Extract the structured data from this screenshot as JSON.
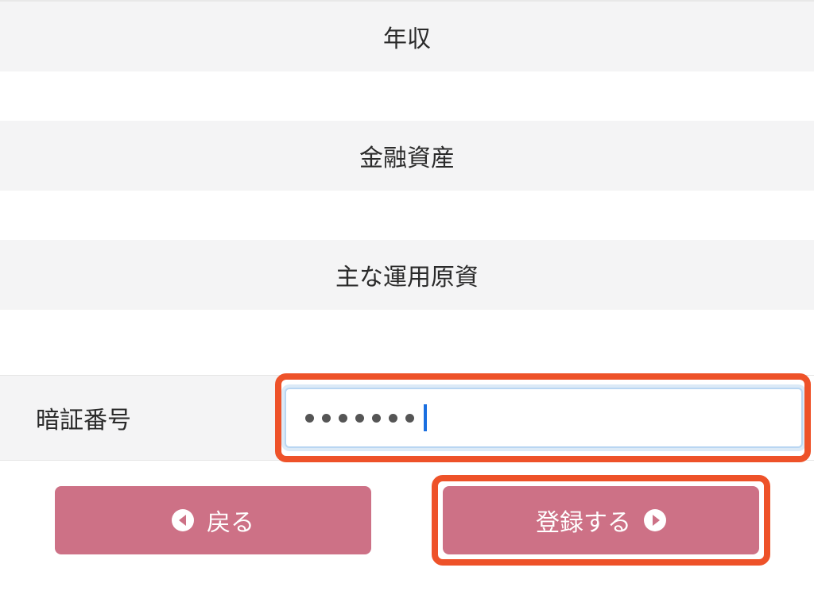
{
  "sections": {
    "income": "年収",
    "assets": "金融資産",
    "funds": "主な運用原資"
  },
  "pin": {
    "label": "暗証番号",
    "value": "•••••••"
  },
  "buttons": {
    "back": "戻る",
    "submit": "登録する"
  },
  "colors": {
    "accent": "#cd7186",
    "highlight": "#ee5229",
    "input_border": "#b9d6f2"
  }
}
